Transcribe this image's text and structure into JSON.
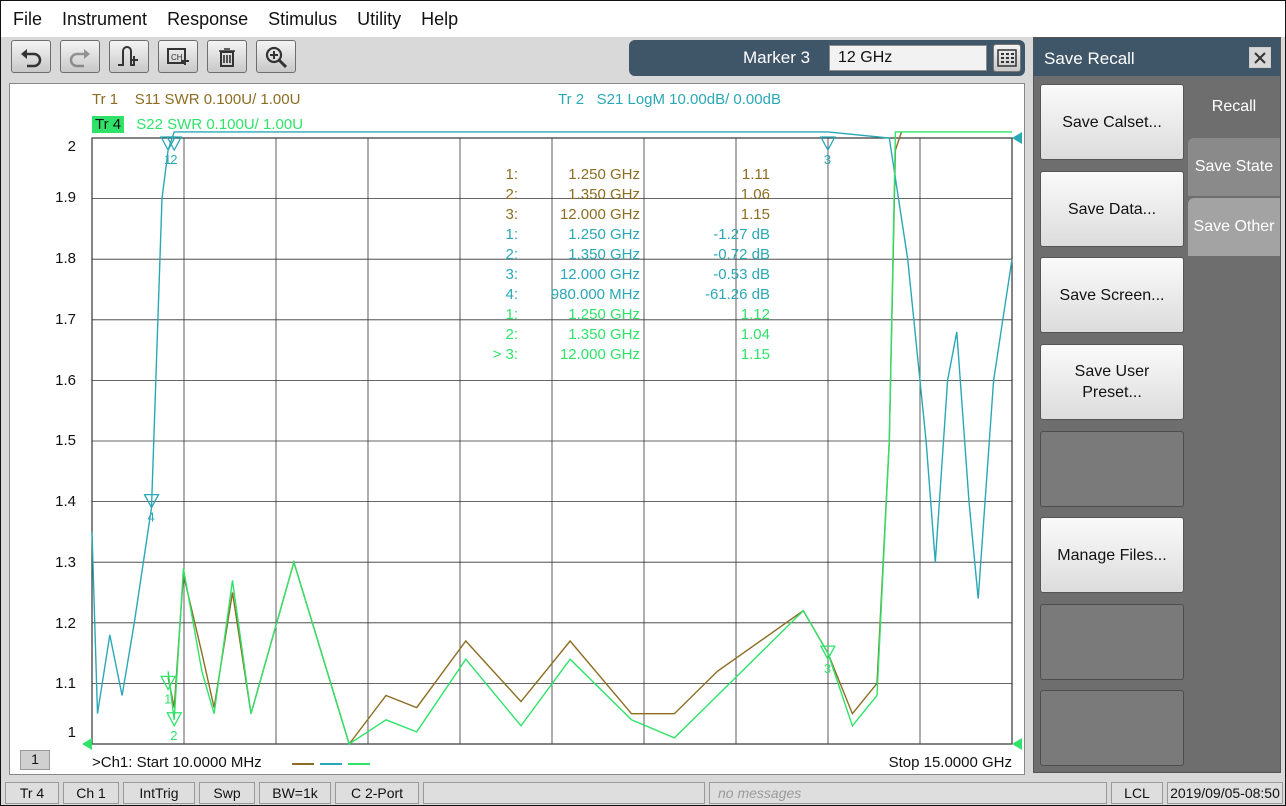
{
  "menu": [
    "File",
    "Instrument",
    "Response",
    "Stimulus",
    "Utility",
    "Help"
  ],
  "toolbar": {
    "buttons": [
      "undo-icon",
      "redo-icon",
      "marker-add-icon",
      "copy-channel-icon",
      "delete-icon",
      "zoom-icon"
    ]
  },
  "marker_entry": {
    "label": "Marker 3",
    "value": "12 GHz",
    "keypad_icon": "keypad-icon"
  },
  "traces": {
    "tr1": {
      "id": "Tr  1",
      "desc": "S11 SWR 0.100U/  1.00U",
      "color": "#8c6d22"
    },
    "tr2": {
      "id": "Tr  2",
      "desc": "S21 LogM 10.00dB/  0.00dB",
      "color": "#2aa8b5"
    },
    "tr4": {
      "id": "Tr  4",
      "desc": "S22 SWR 0.100U/  1.00U",
      "color": "#2fe36a"
    }
  },
  "marker_table": [
    {
      "num": "1:",
      "freq": "1.250  GHz",
      "value": "1.11",
      "color": "#8c6d22"
    },
    {
      "num": "2:",
      "freq": "1.350  GHz",
      "value": "1.06",
      "color": "#8c6d22"
    },
    {
      "num": "3:",
      "freq": "12.000  GHz",
      "value": "1.15",
      "color": "#8c6d22"
    },
    {
      "num": "1:",
      "freq": "1.250  GHz",
      "value": "-1.27 dB",
      "color": "#2aa8b5"
    },
    {
      "num": "2:",
      "freq": "1.350  GHz",
      "value": "-0.72 dB",
      "color": "#2aa8b5"
    },
    {
      "num": "3:",
      "freq": "12.000  GHz",
      "value": "-0.53 dB",
      "color": "#2aa8b5"
    },
    {
      "num": "4:",
      "freq": "980.000  MHz",
      "value": "-61.26 dB",
      "color": "#2aa8b5"
    },
    {
      "num": "1:",
      "freq": "1.250  GHz",
      "value": "1.12",
      "color": "#2fe36a"
    },
    {
      "num": "2:",
      "freq": "1.350  GHz",
      "value": "1.04",
      "color": "#2fe36a"
    },
    {
      "num": "> 3:",
      "freq": "12.000  GHz",
      "value": "1.15",
      "color": "#2fe36a"
    }
  ],
  "channel": {
    "number": "1",
    "start": ">Ch1:  Start  10.0000 MHz",
    "stop": "Stop  15.0000 GHz"
  },
  "chart_data": {
    "type": "line",
    "yticks": [
      "2",
      "1.9",
      "1.8",
      "1.7",
      "1.6",
      "1.5",
      "1.4",
      "1.3",
      "1.2",
      "1.1",
      "1"
    ],
    "ylim": [
      1.0,
      2.0
    ],
    "xlim_ghz": [
      0.01,
      15.0
    ],
    "series": [
      {
        "name": "S11 SWR",
        "color": "#8c6d22",
        "points": [
          [
            1.25,
            1.11
          ],
          [
            1.35,
            1.06
          ],
          [
            1.5,
            1.28
          ],
          [
            1.8,
            1.15
          ],
          [
            2.0,
            1.06
          ],
          [
            2.3,
            1.25
          ],
          [
            2.6,
            1.05
          ],
          [
            3.3,
            1.3
          ],
          [
            4.2,
            1.0
          ],
          [
            4.8,
            1.08
          ],
          [
            5.3,
            1.06
          ],
          [
            6.1,
            1.17
          ],
          [
            7.0,
            1.07
          ],
          [
            7.8,
            1.17
          ],
          [
            8.8,
            1.05
          ],
          [
            9.5,
            1.05
          ],
          [
            10.2,
            1.12
          ],
          [
            11.6,
            1.22
          ],
          [
            12.0,
            1.15
          ],
          [
            12.4,
            1.05
          ],
          [
            12.8,
            1.1
          ],
          [
            13.0,
            1.5
          ],
          [
            13.1,
            1.98
          ],
          [
            13.2,
            2.01
          ]
        ]
      },
      {
        "name": "S21 LogM",
        "color": "#2aa8b5",
        "points": [
          [
            0.01,
            1.35
          ],
          [
            0.1,
            1.05
          ],
          [
            0.3,
            1.18
          ],
          [
            0.5,
            1.08
          ],
          [
            0.7,
            1.2
          ],
          [
            0.98,
            1.39
          ],
          [
            1.15,
            1.9
          ],
          [
            1.25,
            1.98
          ],
          [
            1.35,
            2.01
          ],
          [
            6.0,
            2.01
          ],
          [
            12.0,
            2.01
          ],
          [
            13.0,
            2.0
          ],
          [
            13.3,
            1.8
          ],
          [
            13.6,
            1.5
          ],
          [
            13.75,
            1.3
          ],
          [
            13.95,
            1.6
          ],
          [
            14.1,
            1.68
          ],
          [
            14.3,
            1.4
          ],
          [
            14.45,
            1.24
          ],
          [
            14.7,
            1.6
          ],
          [
            15.0,
            1.8
          ]
        ]
      },
      {
        "name": "S22 SWR",
        "color": "#2fe36a",
        "points": [
          [
            1.25,
            1.12
          ],
          [
            1.35,
            1.04
          ],
          [
            1.5,
            1.29
          ],
          [
            1.8,
            1.12
          ],
          [
            2.0,
            1.05
          ],
          [
            2.3,
            1.27
          ],
          [
            2.6,
            1.05
          ],
          [
            3.3,
            1.3
          ],
          [
            4.2,
            1.0
          ],
          [
            4.8,
            1.04
          ],
          [
            5.3,
            1.02
          ],
          [
            6.1,
            1.14
          ],
          [
            7.0,
            1.03
          ],
          [
            7.8,
            1.14
          ],
          [
            8.8,
            1.04
          ],
          [
            9.5,
            1.01
          ],
          [
            10.2,
            1.08
          ],
          [
            11.6,
            1.22
          ],
          [
            12.0,
            1.15
          ],
          [
            12.4,
            1.03
          ],
          [
            12.8,
            1.08
          ],
          [
            13.0,
            1.5
          ],
          [
            13.1,
            2.01
          ],
          [
            15.0,
            2.01
          ]
        ]
      }
    ],
    "markers": [
      {
        "label": "1",
        "x": 1.25,
        "y": 1.99,
        "color": "#2aa8b5"
      },
      {
        "label": "2",
        "x": 1.35,
        "y": 1.99,
        "color": "#2aa8b5"
      },
      {
        "label": "3",
        "x": 12.0,
        "y": 1.99,
        "color": "#2aa8b5"
      },
      {
        "label": "4",
        "x": 0.98,
        "y": 1.4,
        "color": "#2aa8b5"
      },
      {
        "label": "1",
        "x": 1.25,
        "y": 1.1,
        "color": "#2fe36a"
      },
      {
        "label": "2",
        "x": 1.35,
        "y": 1.04,
        "color": "#2fe36a"
      },
      {
        "label": "3",
        "x": 12.0,
        "y": 1.15,
        "color": "#2fe36a"
      }
    ]
  },
  "panel": {
    "title": "Save Recall",
    "buttons": [
      "Save Calset...",
      "Save Data...",
      "Save Screen...",
      "Save User Preset...",
      "",
      "Manage Files...",
      "",
      ""
    ],
    "tabs": [
      "Recall",
      "Save State",
      "Save Other"
    ]
  },
  "status": {
    "trace": "Tr 4",
    "channel": "Ch 1",
    "trigger": "IntTrig",
    "sweep": "Swp",
    "bw": "BW=1k",
    "cal": "C  2-Port",
    "blank": "",
    "message": "no messages",
    "lcl": "LCL",
    "datetime": "2019/09/05-08:50"
  }
}
